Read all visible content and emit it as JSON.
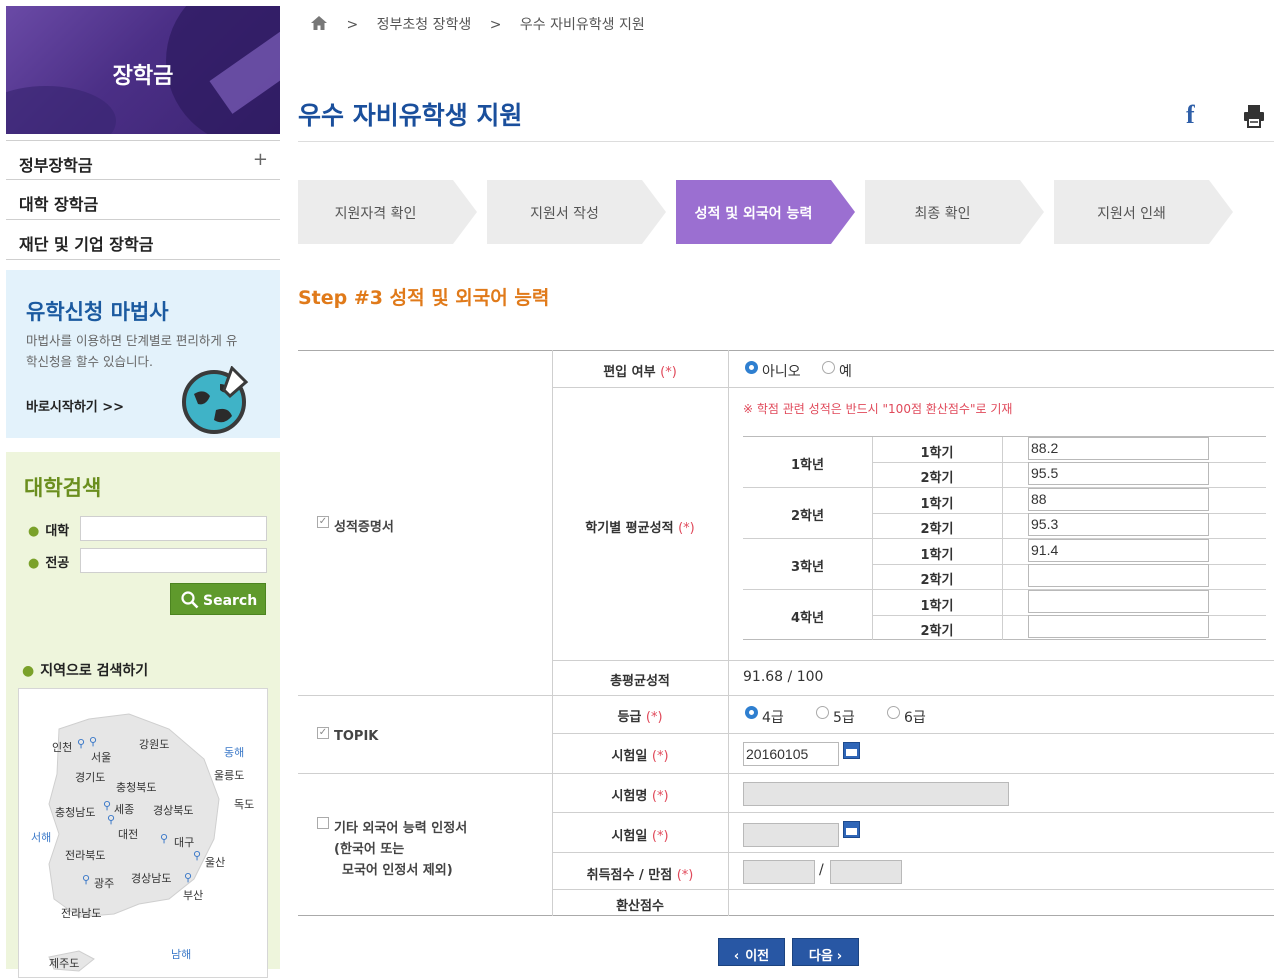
{
  "sidebar": {
    "banner_title": "장학금",
    "menu": [
      {
        "label": "정부장학금",
        "plus": "+"
      },
      {
        "label": "대학 장학금"
      },
      {
        "label": "재단 및 기업 장학금"
      }
    ],
    "wizard": {
      "title": "유학신청 마법사",
      "desc": "마법사를 이용하면 단계별로 편리하게 유학신청을 할수 있습니다.",
      "link": "바로시작하기 >>"
    },
    "search": {
      "title": "대학검색",
      "university_label": "대학",
      "major_label": "전공",
      "button": "Search",
      "region_label": "지역으로 검색하기"
    },
    "map_labels": [
      "인천",
      "서울",
      "강원도",
      "동해",
      "경기도",
      "울릉도",
      "충청북도",
      "독도",
      "충청남도",
      "세종",
      "경상북도",
      "서해",
      "대전",
      "대구",
      "전라북도",
      "울산",
      "광주",
      "경상남도",
      "부산",
      "전라남도",
      "남해",
      "제주도"
    ]
  },
  "breadcrumb": [
    "정부초청 장학생",
    "우수 자비유학생 지원"
  ],
  "page_title": "우수 자비유학생 지원",
  "steps": [
    {
      "label": "지원자격 확인",
      "active": false
    },
    {
      "label": "지원서 작성",
      "active": false
    },
    {
      "label": "성적 및 외국어 능력",
      "active": true
    },
    {
      "label": "최종 확인",
      "active": false
    },
    {
      "label": "지원서 인쇄",
      "active": false
    }
  ],
  "step_heading": "Step #3 성적 및 외국어 능력",
  "form": {
    "transcript_label": "성적증명서",
    "transfer": {
      "label": "편입 여부",
      "req": "(*)",
      "options": [
        "아니오",
        "예"
      ],
      "selected": "아니오"
    },
    "grade_note": "※ 학점 관련 성적은 반드시 \"100점 환산점수\"로 기재",
    "semester_label": "학기별 평균성적",
    "req": "(*)",
    "years": [
      {
        "year": "1학년",
        "sem1": "1학기",
        "sem2": "2학기",
        "v1": "88.2",
        "v2": "95.5"
      },
      {
        "year": "2학년",
        "sem1": "1학기",
        "sem2": "2학기",
        "v1": "88",
        "v2": "95.3"
      },
      {
        "year": "3학년",
        "sem1": "1학기",
        "sem2": "2학기",
        "v1": "91.4",
        "v2": ""
      },
      {
        "year": "4학년",
        "sem1": "1학기",
        "sem2": "2학기",
        "v1": "",
        "v2": ""
      }
    ],
    "total_label": "총평균성적",
    "total_value": "91.68 / 100",
    "topik_label": "TOPIK",
    "grade_label": "등급",
    "grade_options": [
      "4급",
      "5급",
      "6급"
    ],
    "grade_selected": "4급",
    "exam_date_label": "시험일",
    "exam_date_value": "20160105",
    "other_label_1": "기타 외국어 능력 인정서",
    "other_label_2": "(한국어 또는",
    "other_label_3": "모국어 인정서 제외)",
    "exam_name_label": "시험명",
    "exam_date2_label": "시험일",
    "score_label": "취득점수 / 만점",
    "slash": "/",
    "converted_label": "환산점수"
  },
  "buttons": {
    "prev": "이전",
    "next": "다음"
  },
  "colors": {
    "accent_purple": "#9b6fd1",
    "title_blue": "#1a4f9c",
    "step_orange": "#e07a1a",
    "button_blue": "#2857a4",
    "required_red": "#e0495a"
  }
}
